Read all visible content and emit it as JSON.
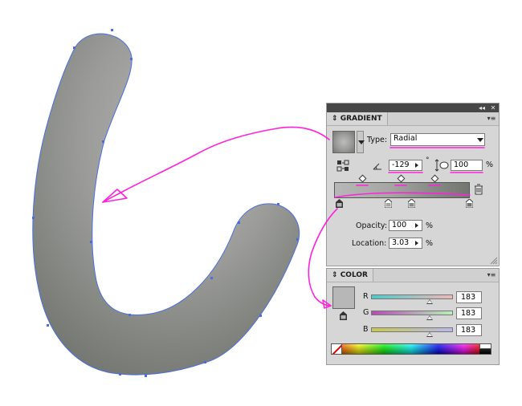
{
  "gradient_panel": {
    "title": "GRADIENT",
    "type_label": "Type:",
    "type_value": "Radial",
    "angle_value": "-129",
    "angle_unit": "°",
    "aspect_value": "100",
    "aspect_unit": "%",
    "opacity_label": "Opacity:",
    "opacity_value": "100",
    "opacity_unit": "%",
    "location_label": "Location:",
    "location_value": "3.03",
    "location_unit": "%"
  },
  "color_panel": {
    "title": "COLOR",
    "channels": [
      {
        "label": "R",
        "value": "183",
        "level": 0.72,
        "from": "#4fc9c9",
        "to": "#f0b8b8"
      },
      {
        "label": "G",
        "value": "183",
        "level": 0.72,
        "from": "#b54bb5",
        "to": "#b8f0b8"
      },
      {
        "label": "B",
        "value": "183",
        "level": 0.72,
        "from": "#c9c94a",
        "to": "#b8b8f0"
      }
    ],
    "swatch_color": "#b7b7b7"
  },
  "colors": {
    "annotation": "#ff22dd",
    "path_outline": "#4a6ee0",
    "shape_light": "#b3b3b1",
    "shape_dark": "#727570"
  },
  "icons": [
    "collapse-icon",
    "close-icon",
    "panel-menu-icon",
    "reverse-gradient-icon",
    "angle-icon",
    "aspect-ratio-icon",
    "delete-stop-icon",
    "none-color-icon"
  ]
}
